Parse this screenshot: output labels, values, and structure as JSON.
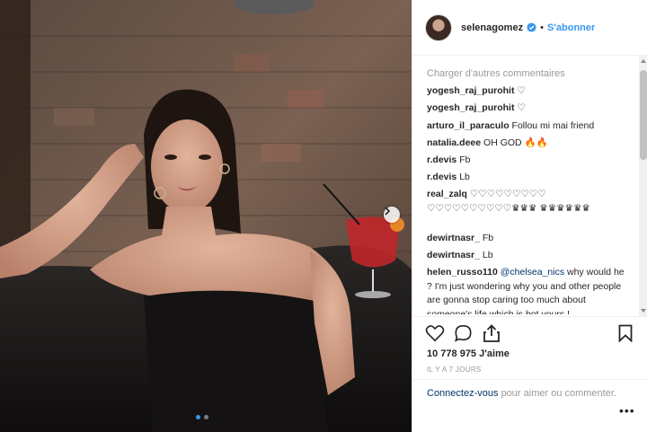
{
  "header": {
    "username": "selenagomez",
    "separator": "•",
    "follow_label": "S'abonner"
  },
  "comments": {
    "load_more": "Charger d'autres commentaires",
    "items": [
      {
        "user": "yogesh_raj_purohit",
        "text": "♡"
      },
      {
        "user": "yogesh_raj_purohit",
        "text": "♡"
      },
      {
        "user": "arturo_il_paraculo",
        "text": "Follou mi mai friend"
      },
      {
        "user": "natalia.deee",
        "text": "OH GOD 🔥🔥"
      },
      {
        "user": "r.devis",
        "text": "Fb"
      },
      {
        "user": "r.devis",
        "text": "Lb"
      },
      {
        "user": "real_zalq",
        "text": "♡♡♡♡♡♡♡♡♡ ♡♡♡♡♡♡♡♡♡♡♛♛♛ ♛♛♛♛♛♛"
      },
      {
        "user": "dewirtnasr_",
        "text": "Fb"
      },
      {
        "user": "dewirtnasr_",
        "text": "Lb"
      },
      {
        "user": "helen_russo110",
        "mention": "@chelsea_nics",
        "text": "why would he ? I'm just wondering why you and other people are gonna stop caring too much about someone's life which is bot yours.I"
      }
    ]
  },
  "post": {
    "likes": "10 778 975 J'aime",
    "time": "IL Y A 7 JOURS"
  },
  "add_comment": {
    "login_link": "Connectez-vous",
    "text": "pour aimer ou commenter.",
    "more": "•••"
  },
  "icons": {
    "like": "heart-icon",
    "comment": "comment-icon",
    "share": "share-icon",
    "save": "bookmark-icon",
    "verified": "verified-badge-icon",
    "next": "chevron-right-icon"
  },
  "colors": {
    "accent": "#3897f0",
    "link": "#003569",
    "muted": "#999999",
    "text": "#262626"
  }
}
